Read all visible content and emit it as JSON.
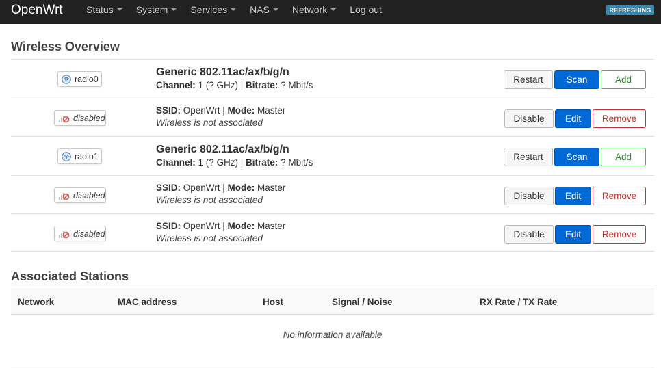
{
  "nav": {
    "brand": "OpenWrt",
    "menu": [
      "Status",
      "System",
      "Services",
      "NAS",
      "Network",
      "Log out"
    ],
    "refreshing": "REFRESHING"
  },
  "wireless": {
    "title": "Wireless Overview",
    "radios": [
      {
        "badge": "radio0",
        "device": "Generic 802.11ac/ax/b/g/n",
        "channel_label": "Channel:",
        "channel_value": " 1 (? GHz) | ",
        "bitrate_label": "Bitrate:",
        "bitrate_value": " ? Mbit/s",
        "restart": "Restart",
        "scan": "Scan",
        "add": "Add",
        "networks": [
          {
            "badge": "disabled",
            "ssid_label": "SSID:",
            "ssid_value": " OpenWrt | ",
            "mode_label": "Mode:",
            "mode_value": " Master",
            "status": "Wireless is not associated",
            "disable": "Disable",
            "edit": "Edit",
            "remove": "Remove"
          }
        ]
      },
      {
        "badge": "radio1",
        "device": "Generic 802.11ac/ax/b/g/n",
        "channel_label": "Channel:",
        "channel_value": " 1 (? GHz) | ",
        "bitrate_label": "Bitrate:",
        "bitrate_value": " ? Mbit/s",
        "restart": "Restart",
        "scan": "Scan",
        "add": "Add",
        "networks": [
          {
            "badge": "disabled",
            "ssid_label": "SSID:",
            "ssid_value": " OpenWrt | ",
            "mode_label": "Mode:",
            "mode_value": " Master",
            "status": "Wireless is not associated",
            "disable": "Disable",
            "edit": "Edit",
            "remove": "Remove"
          },
          {
            "badge": "disabled",
            "ssid_label": "SSID:",
            "ssid_value": " OpenWrt | ",
            "mode_label": "Mode:",
            "mode_value": " Master",
            "status": "Wireless is not associated",
            "disable": "Disable",
            "edit": "Edit",
            "remove": "Remove"
          }
        ]
      }
    ]
  },
  "stations": {
    "title": "Associated Stations",
    "columns": [
      "Network",
      "MAC address",
      "Host",
      "Signal / Noise",
      "RX Rate / TX Rate"
    ],
    "empty": "No information available"
  },
  "colors": {
    "navbar": "#222222",
    "primary": "#0069d6",
    "success": "#4cae4c",
    "danger": "#c9302c",
    "refresh_badge": "#3a87ad"
  },
  "icons": {
    "radio": "wifi-radio-icon",
    "disabled": "signal-disabled-icon"
  }
}
